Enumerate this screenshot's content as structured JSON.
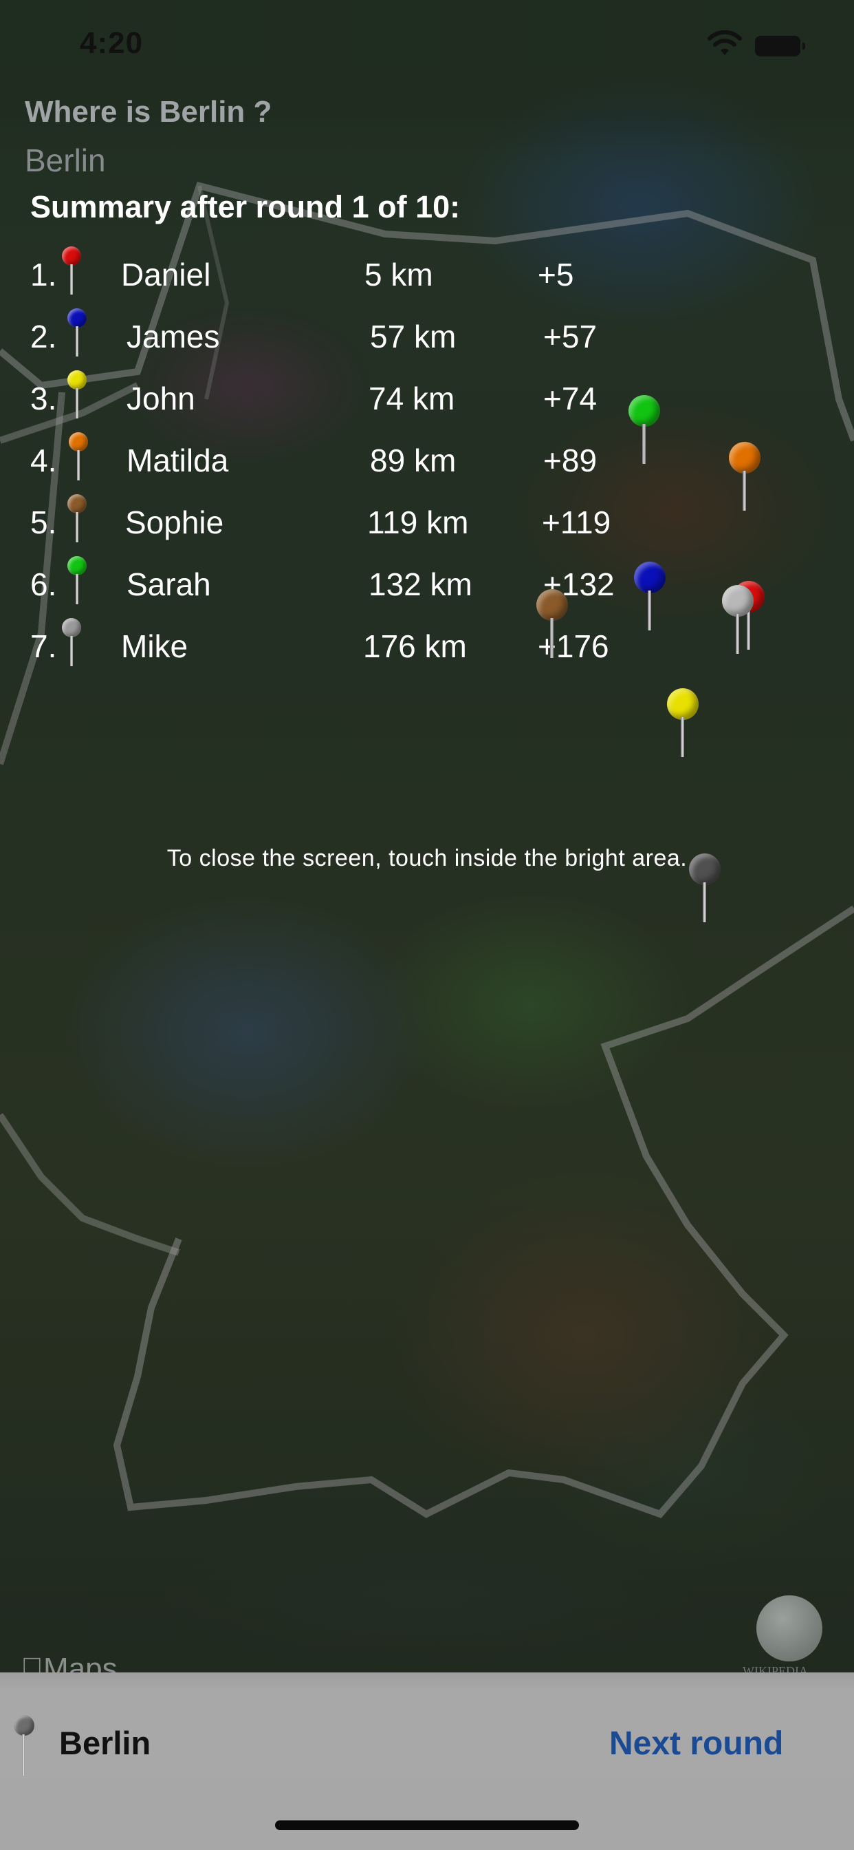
{
  "status_bar": {
    "time": "4:20",
    "icons": [
      "wifi-icon",
      "battery-icon"
    ]
  },
  "header": {
    "question": "Where is Berlin ?",
    "answer": "Berlin"
  },
  "summary": {
    "title": "Summary after round 1 of 10:",
    "rows": [
      {
        "rank": "1.",
        "name": "Daniel",
        "distance": "5 km",
        "score": "+5",
        "pin_color": "#d80c0c"
      },
      {
        "rank": "2.",
        "name": "James",
        "distance": "57 km",
        "score": "+57",
        "pin_color": "#0a10b8"
      },
      {
        "rank": "3.",
        "name": "John",
        "distance": "74 km",
        "score": "+74",
        "pin_color": "#e8e000"
      },
      {
        "rank": "4.",
        "name": "Matilda",
        "distance": "89 km",
        "score": "+89",
        "pin_color": "#e07000"
      },
      {
        "rank": "5.",
        "name": "Sophie",
        "distance": "119 km",
        "score": "+119",
        "pin_color": "#8a5a2a"
      },
      {
        "rank": "6.",
        "name": "Sarah",
        "distance": "132 km",
        "score": "+132",
        "pin_color": "#12c412"
      },
      {
        "rank": "7.",
        "name": "Mike",
        "distance": "176 km",
        "score": "+176",
        "pin_color": "#9a9a9a"
      }
    ]
  },
  "hint": "To close the screen, touch inside the bright area.",
  "map": {
    "attribution": "Maps",
    "wiki_caption": "WIKIPEDIA"
  },
  "bottom_bar": {
    "city": "Berlin",
    "next_button": "Next round"
  }
}
